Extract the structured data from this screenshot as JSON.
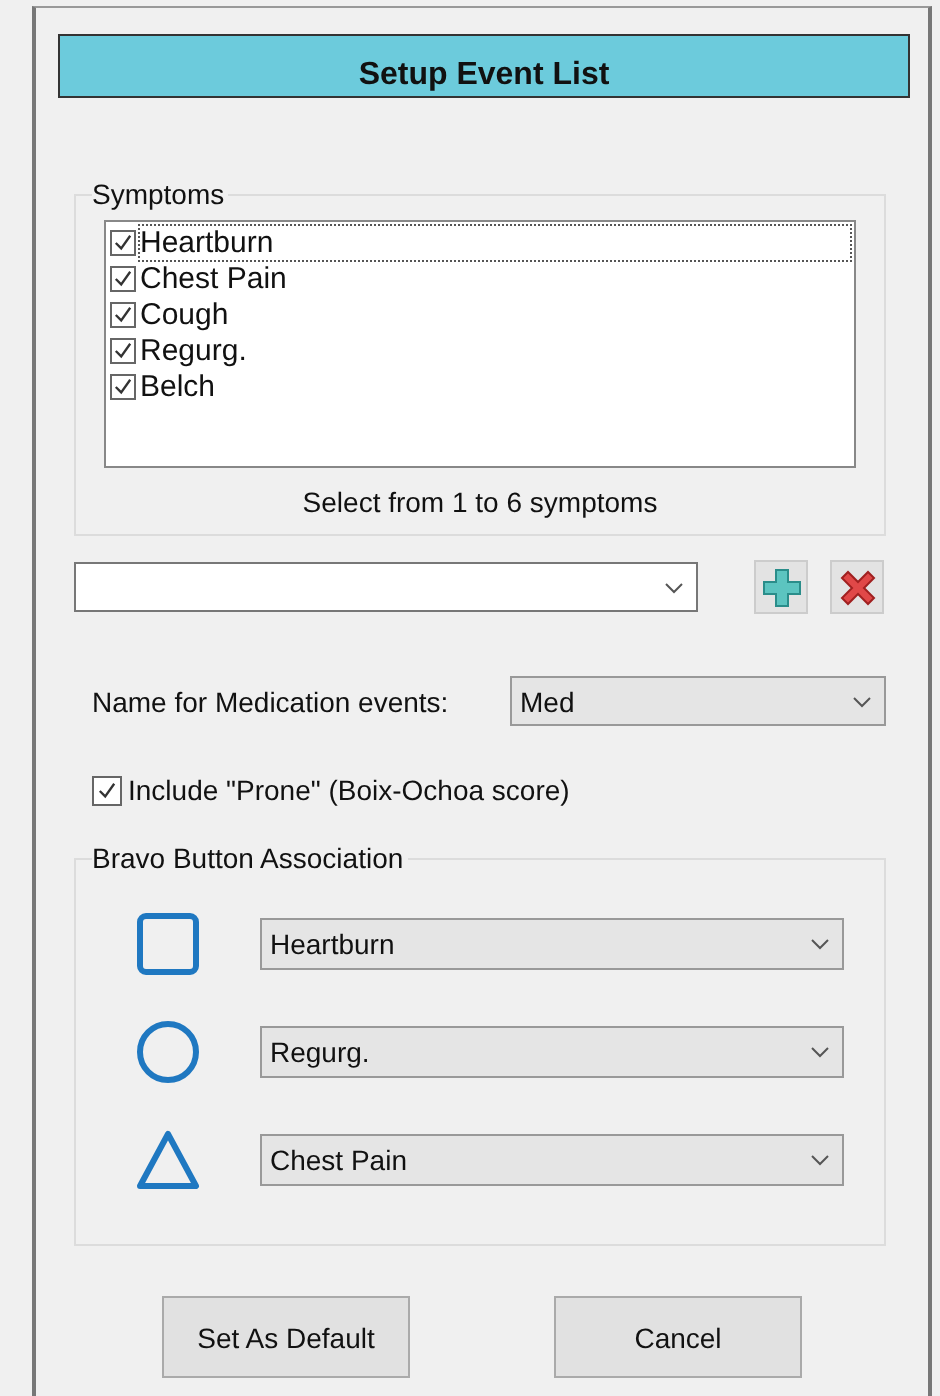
{
  "title": "Setup Event List",
  "symptoms": {
    "label": "Symptoms",
    "items": [
      {
        "label": "Heartburn",
        "checked": true,
        "selected": true
      },
      {
        "label": "Chest Pain",
        "checked": true,
        "selected": false
      },
      {
        "label": "Cough",
        "checked": true,
        "selected": false
      },
      {
        "label": "Regurg.",
        "checked": true,
        "selected": false
      },
      {
        "label": "Belch",
        "checked": true,
        "selected": false
      }
    ],
    "hint": "Select from 1 to 6 symptoms"
  },
  "medication": {
    "label": "Name for Medication events:",
    "value": "Med"
  },
  "prone": {
    "label": "Include \"Prone\" (Boix-Ochoa score)",
    "checked": true
  },
  "bravo": {
    "label": "Bravo Button Association",
    "rows": [
      {
        "kind": "square",
        "value": "Heartburn"
      },
      {
        "kind": "circle",
        "value": "Regurg."
      },
      {
        "kind": "triangle",
        "value": "Chest Pain"
      }
    ]
  },
  "buttons": [
    "Set As Default",
    "Cancel"
  ]
}
